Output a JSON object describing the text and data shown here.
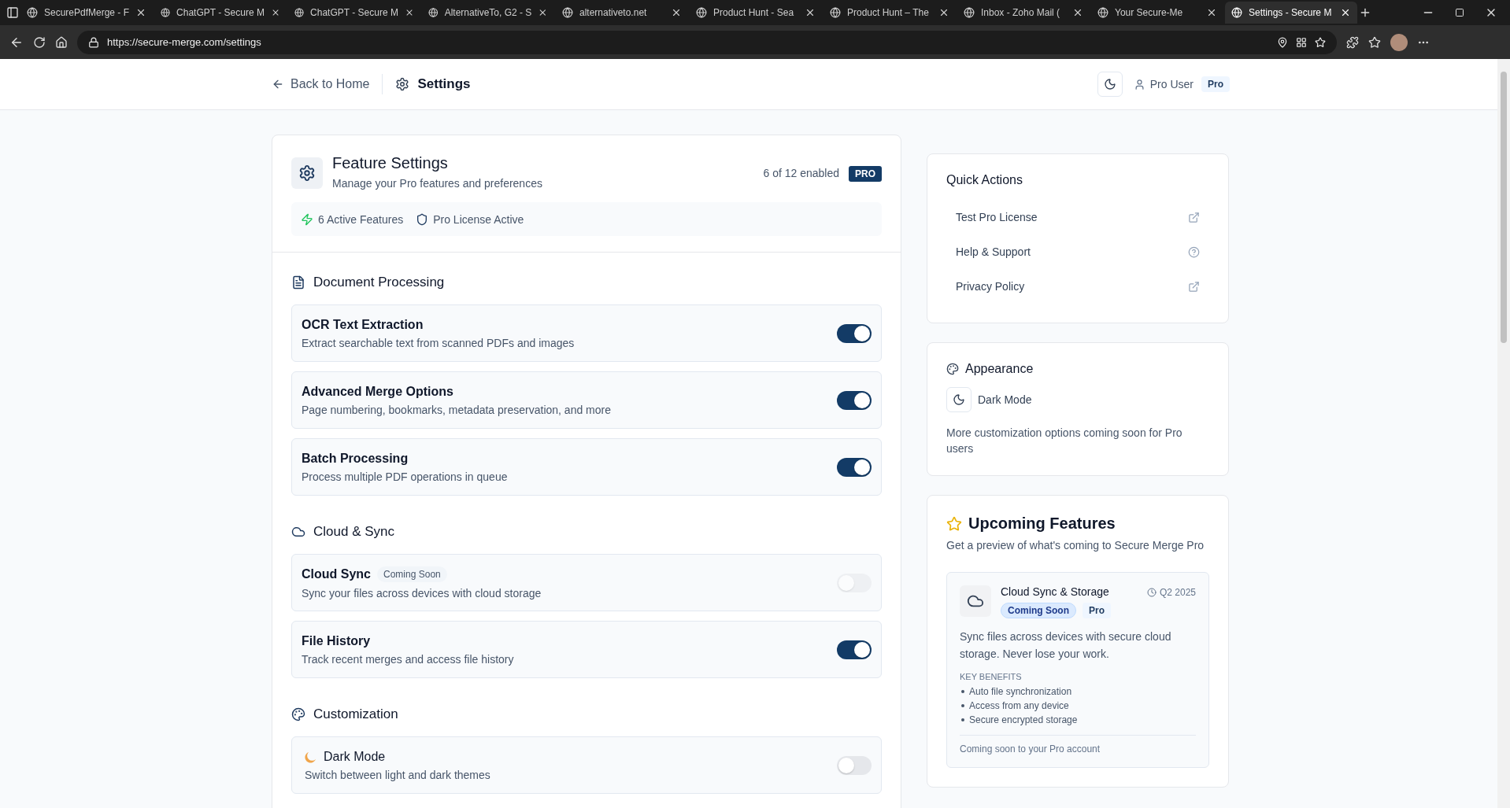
{
  "browser": {
    "tabs": [
      {
        "title": "SecurePdfMerge - F",
        "selected": false
      },
      {
        "title": "ChatGPT - Secure M",
        "selected": false
      },
      {
        "title": "ChatGPT - Secure M",
        "selected": false
      },
      {
        "title": "AlternativeTo, G2 - S",
        "selected": false
      },
      {
        "title": "alternativeto.net",
        "selected": false
      },
      {
        "title": "Product Hunt - Sea",
        "selected": false
      },
      {
        "title": "Product Hunt – The",
        "selected": false
      },
      {
        "title": "Inbox - Zoho Mail (",
        "selected": false
      },
      {
        "title": "Your Secure-Me",
        "selected": false
      },
      {
        "title": "Settings - Secure M",
        "selected": true
      }
    ],
    "address": "https://secure-merge.com/settings"
  },
  "header": {
    "back": "Back to Home",
    "title": "Settings",
    "user": "Pro User",
    "badge": "Pro"
  },
  "feature_settings": {
    "title": "Feature Settings",
    "subtitle": "Manage your Pro features and preferences",
    "count": "6 of 12 enabled",
    "badge": "PRO",
    "stats": [
      "6 Active Features",
      "Pro License Active"
    ],
    "sections": [
      {
        "title": "Document Processing",
        "items": [
          {
            "kind": "plain",
            "title": "OCR Text Extraction",
            "description": "Extract searchable text from scanned PDFs and images",
            "on": true,
            "disabled": false
          },
          {
            "kind": "plain",
            "title": "Advanced Merge Options",
            "description": "Page numbering, bookmarks, metadata preservation, and more",
            "on": true,
            "disabled": false
          },
          {
            "kind": "plain",
            "title": "Batch Processing",
            "description": "Process multiple PDF operations in queue",
            "on": true,
            "disabled": false
          }
        ]
      },
      {
        "title": "Cloud & Sync",
        "items": [
          {
            "kind": "plain",
            "title": "Cloud Sync",
            "badge": "Coming Soon",
            "description": "Sync your files across devices with cloud storage",
            "on": false,
            "disabled": true
          },
          {
            "kind": "plain",
            "title": "File History",
            "description": "Track recent merges and access file history",
            "on": true,
            "disabled": false
          }
        ]
      },
      {
        "title": "Customization",
        "items": [
          {
            "kind": "moon",
            "title": "Dark Mode",
            "description": "Switch between light and dark themes",
            "on": false,
            "disabled": false
          }
        ]
      }
    ]
  },
  "quick_actions": {
    "title": "Quick Actions",
    "items": [
      {
        "label": "Test Pro License",
        "kind": "external"
      },
      {
        "label": "Help & Support",
        "kind": "help"
      },
      {
        "label": "Privacy Policy",
        "kind": "external"
      }
    ]
  },
  "appearance": {
    "title": "Appearance",
    "toggle": "Dark Mode",
    "note": "More customization options coming soon for Pro users"
  },
  "upcoming": {
    "title": "Upcoming Features",
    "subtitle": "Get a preview of what's coming to Secure Merge Pro",
    "feature": {
      "title": "Cloud Sync & Storage",
      "date": "Q2 2025",
      "status": "Coming Soon",
      "tier": "Pro",
      "description": "Sync files across devices with secure cloud storage. Never lose your work.",
      "benefits_title": "KEY BENEFITS",
      "benefits": [
        "Auto file synchronization",
        "Access from any device",
        "Secure encrypted storage"
      ],
      "footer": "Coming soon to your Pro account"
    }
  }
}
